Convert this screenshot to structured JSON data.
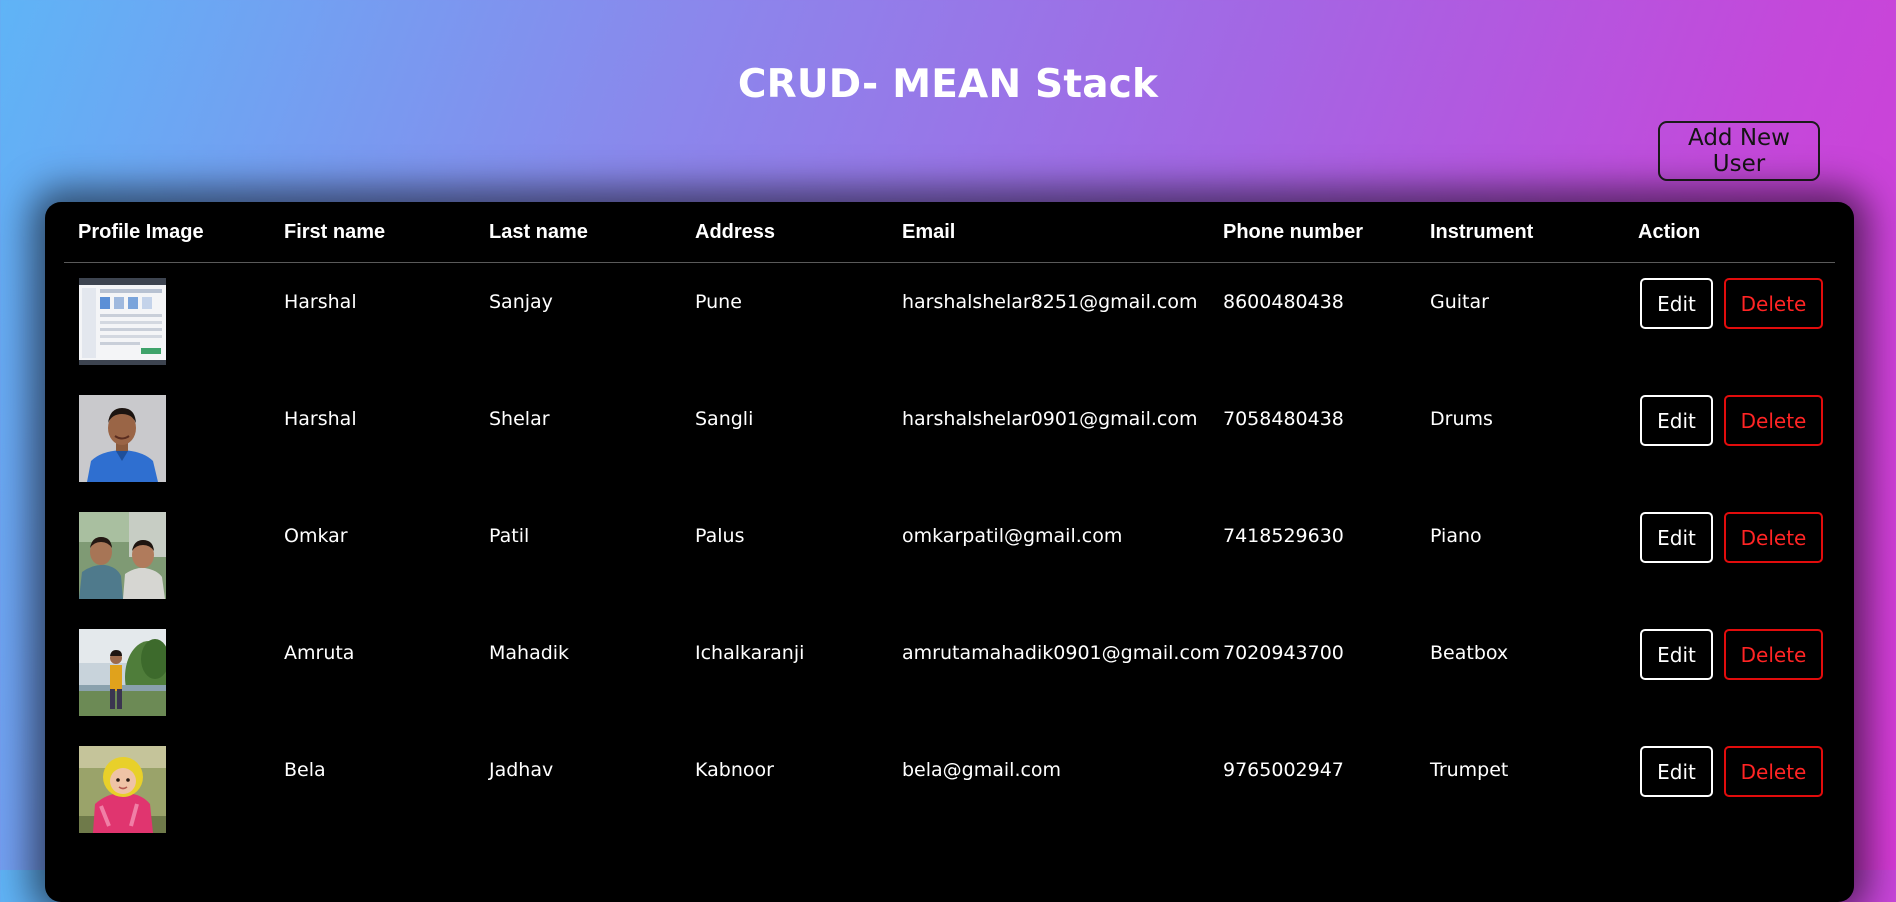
{
  "page": {
    "title": "CRUD- MEAN Stack",
    "add_button_label": "Add New User"
  },
  "table": {
    "headers": [
      "Profile Image",
      "First name",
      "Last name",
      "Address",
      "Email",
      "Phone number",
      "Instrument",
      "Action"
    ],
    "edit_label": "Edit",
    "delete_label": "Delete",
    "rows": [
      {
        "image": "screenshot-thumbnail",
        "first_name": "Harshal",
        "last_name": "Sanjay",
        "address": "Pune",
        "email": "harshalshelar8251@gmail.com",
        "phone": "8600480438",
        "instrument": "Guitar"
      },
      {
        "image": "man-blue-shirt-photo",
        "first_name": "Harshal",
        "last_name": "Shelar",
        "address": "Sangli",
        "email": "harshalshelar0901@gmail.com",
        "phone": "7058480438",
        "instrument": "Drums"
      },
      {
        "image": "two-friends-photo",
        "first_name": "Omkar",
        "last_name": "Patil",
        "address": "Palus",
        "email": "omkarpatil@gmail.com",
        "phone": "7418529630",
        "instrument": "Piano"
      },
      {
        "image": "lakeside-person-photo",
        "first_name": "Amruta",
        "last_name": "Mahadik",
        "address": "Ichalkaranji",
        "email": "amrutamahadik0901@gmail.com",
        "phone": "7020943700",
        "instrument": "Beatbox"
      },
      {
        "image": "child-pink-outfit-photo",
        "first_name": "Bela",
        "last_name": "Jadhav",
        "address": "Kabnoor",
        "email": "bela@gmail.com",
        "phone": "9765002947",
        "instrument": "Trumpet"
      }
    ]
  },
  "colors": {
    "gradient_start": "#5fb4f6",
    "gradient_end": "#d63ad6",
    "table_background": "#000000",
    "delete_accent": "#e20c0c"
  }
}
